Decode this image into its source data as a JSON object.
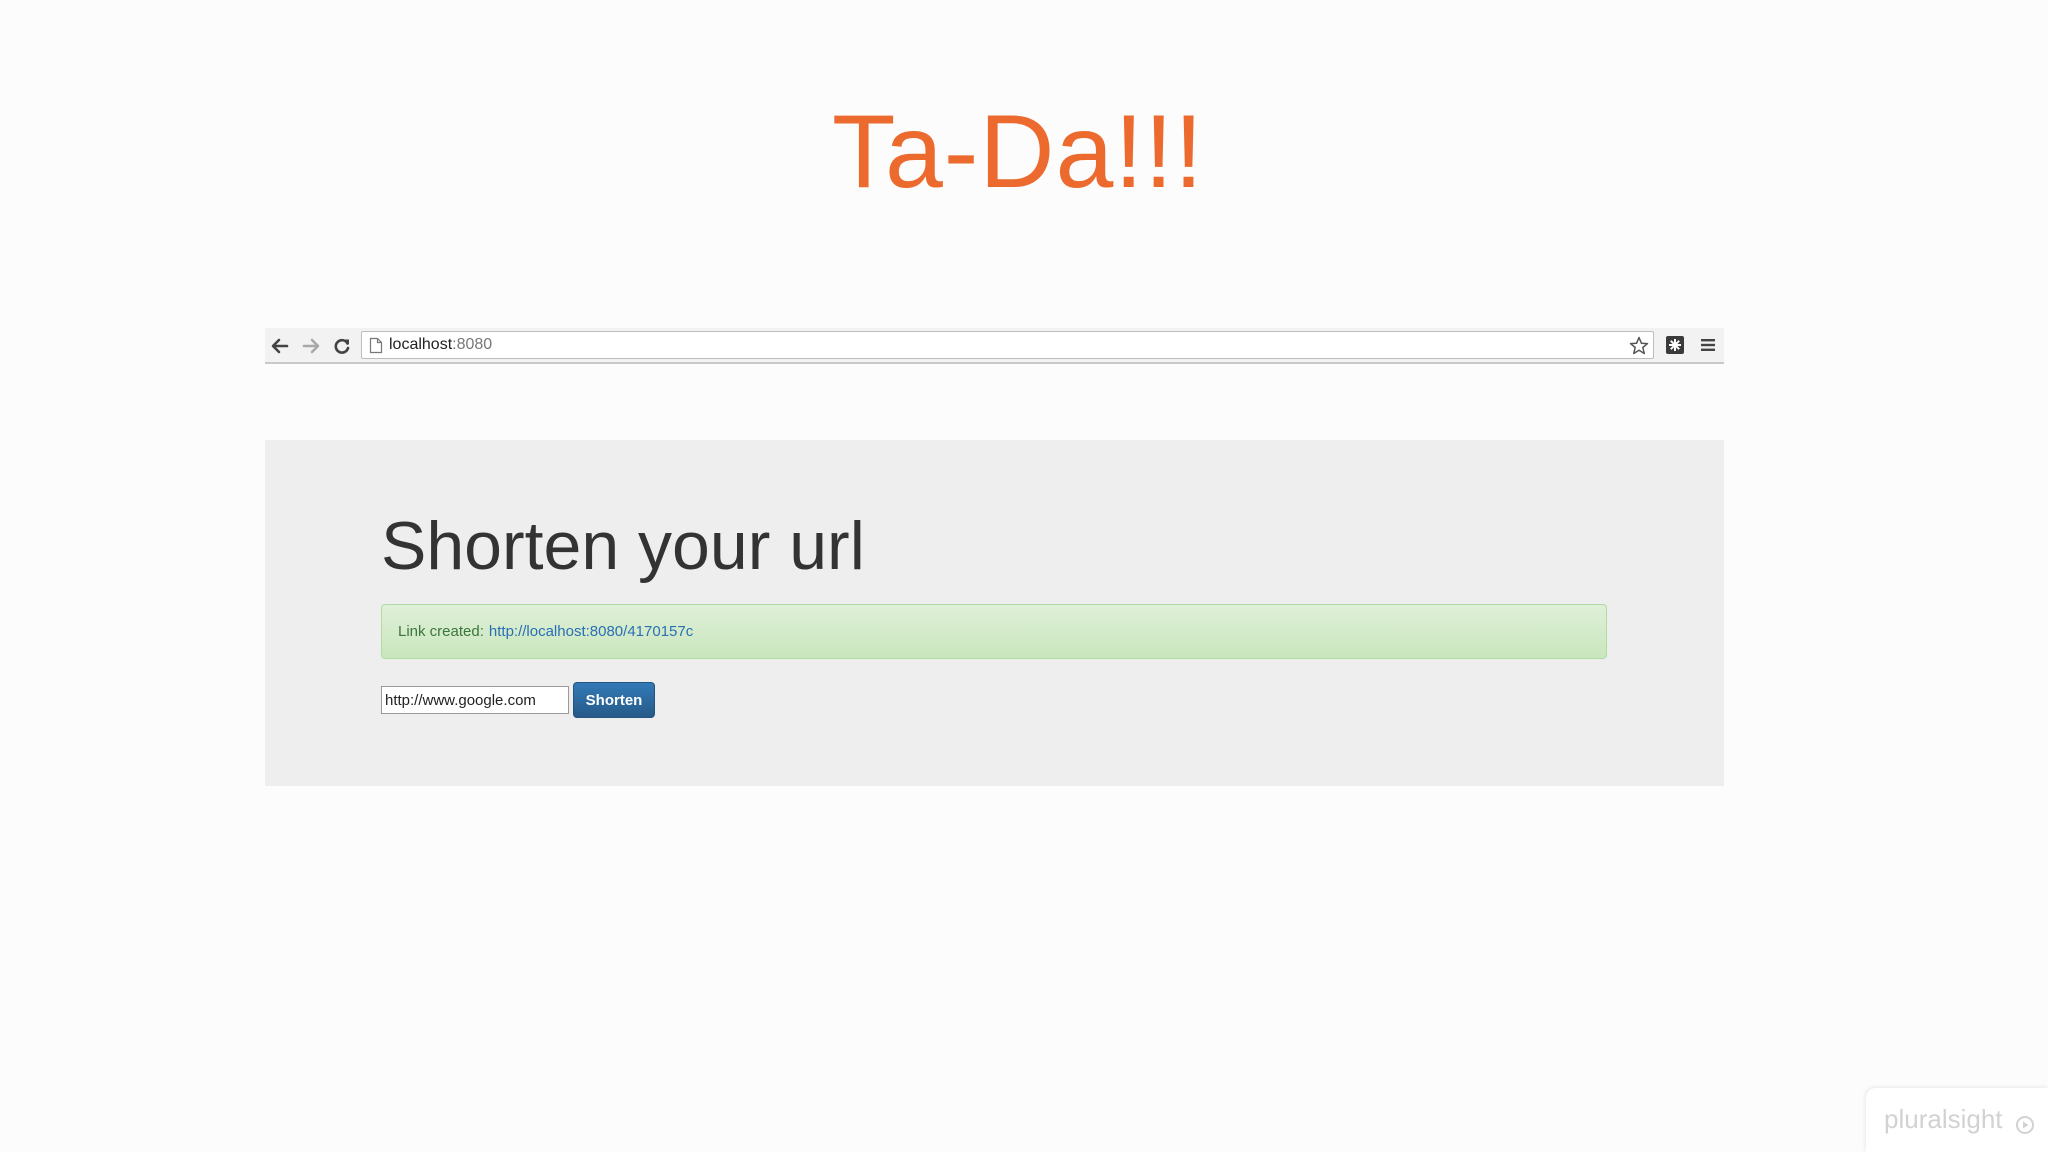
{
  "slide": {
    "title": "Ta-Da!!!",
    "title_color": "#ec6a2e"
  },
  "browser": {
    "url_host": "localhost",
    "url_port": ":8080",
    "icons": [
      "back-arrow-icon",
      "forward-arrow-icon",
      "reload-icon",
      "page-icon",
      "star-icon",
      "extension-icon",
      "menu-icon"
    ]
  },
  "page": {
    "heading": "Shorten your url",
    "alert": {
      "label": "Link created:",
      "link": "http://localhost:8080/4170157c"
    },
    "form": {
      "url_value": "http://www.google.com",
      "submit_label": "Shorten"
    }
  },
  "watermark": {
    "brand": "pluralsight"
  }
}
